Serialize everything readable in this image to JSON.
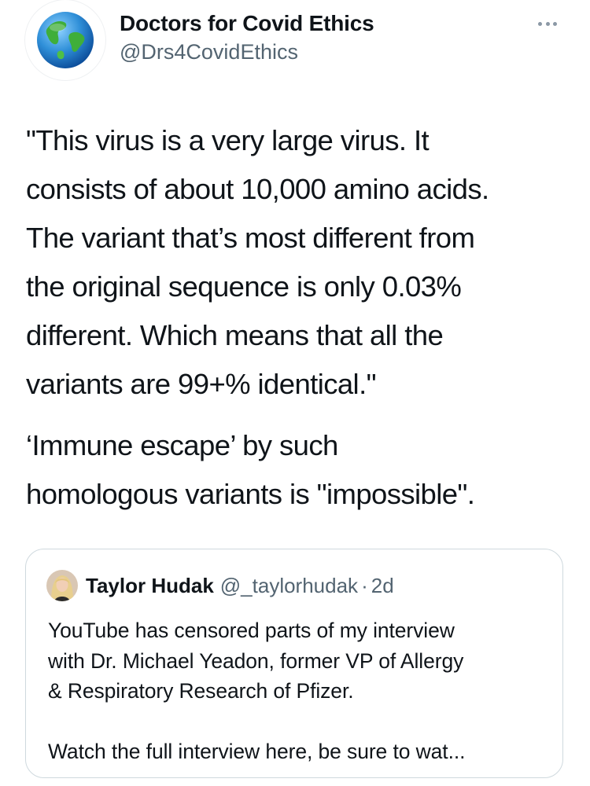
{
  "author": {
    "name": "Doctors for Covid Ethics",
    "handle": "@Drs4CovidEthics",
    "avatar_icon": "globe-icon"
  },
  "menu": {
    "more_icon": "more-horizontal-icon"
  },
  "tweet": {
    "paragraphs": [
      "\"This virus is a very large virus. It\nconsists of about 10,000 amino acids.\nThe variant that’s most different from\nthe original sequence is only 0.03%\ndifferent. Which means that all the\nvariants are 99+% identical.\"",
      "‘Immune escape’ by such\nhomologous variants is \"impossible\"."
    ]
  },
  "quoted_tweet": {
    "name": "Taylor Hudak",
    "handle": "@_taylorhudak",
    "separator": "·",
    "time": "2d",
    "paragraphs": [
      "YouTube has censored parts of my interview\nwith Dr. Michael Yeadon, former VP of Allergy\n& Respiratory Research of Pfizer.",
      "Watch the full interview here, be sure to wat..."
    ]
  },
  "colors": {
    "text": "#0f1419",
    "secondary": "#536471",
    "border": "#cfd9de",
    "globe_ocean": "#2f8fd8",
    "globe_land": "#3fae3a"
  }
}
